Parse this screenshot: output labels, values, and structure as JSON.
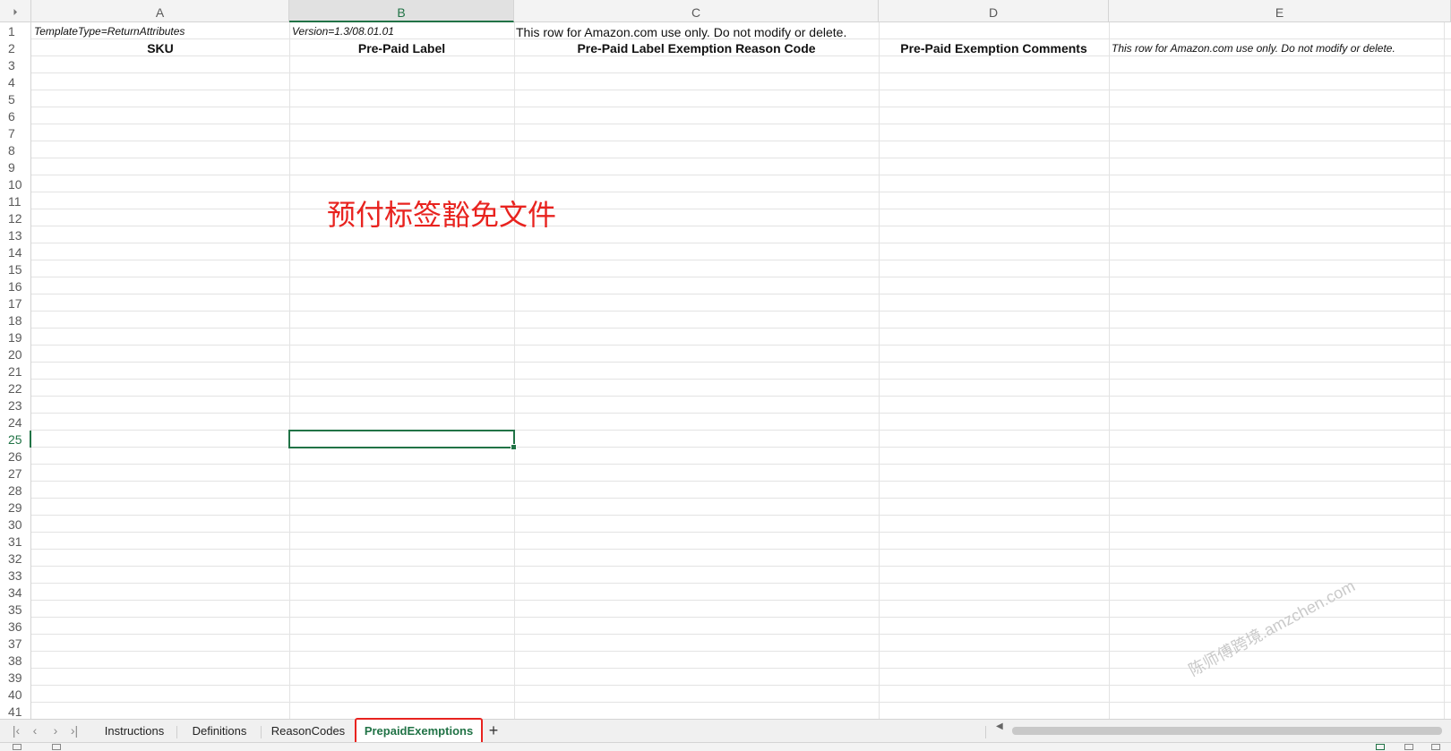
{
  "columns": [
    {
      "letter": "A"
    },
    {
      "letter": "B"
    },
    {
      "letter": "C"
    },
    {
      "letter": "D"
    },
    {
      "letter": "E"
    }
  ],
  "row_numbers": [
    "1",
    "2",
    "3",
    "4",
    "5",
    "6",
    "7",
    "8",
    "9",
    "10",
    "11",
    "12",
    "13",
    "14",
    "15",
    "16",
    "17",
    "18",
    "19",
    "20",
    "21",
    "22",
    "23",
    "24",
    "25",
    "26",
    "27",
    "28",
    "29",
    "30",
    "31",
    "32",
    "33",
    "34",
    "35",
    "36",
    "37",
    "38",
    "39",
    "40",
    "41"
  ],
  "selected_cell": "B25",
  "cells": {
    "A1": "TemplateType=ReturnAttributes",
    "B1": "Version=1.3/08.01.01",
    "C1": "This row for Amazon.com use only.  Do not modify or delete.",
    "A2": "SKU",
    "B2": "Pre-Paid Label",
    "C2": "Pre-Paid Label Exemption Reason Code",
    "D2": "Pre-Paid Exemption Comments",
    "E2": "This row for Amazon.com use only.  Do not modify or delete."
  },
  "overlay_text": "预付标签豁免文件",
  "watermark": "陈师傅跨境.amzchen.com",
  "tabs": [
    {
      "label": "Instructions",
      "active": false
    },
    {
      "label": "Definitions",
      "active": false
    },
    {
      "label": "ReasonCodes",
      "active": false
    },
    {
      "label": "PrepaidExemptions",
      "active": true
    }
  ],
  "add_tab_label": "+",
  "nav_icons": [
    "first-sheet-icon",
    "prev-sheet-icon",
    "next-sheet-icon",
    "last-sheet-icon"
  ],
  "colors": {
    "accent": "#217346",
    "highlight": "#e8231f",
    "grid": "#e3e3e3"
  }
}
